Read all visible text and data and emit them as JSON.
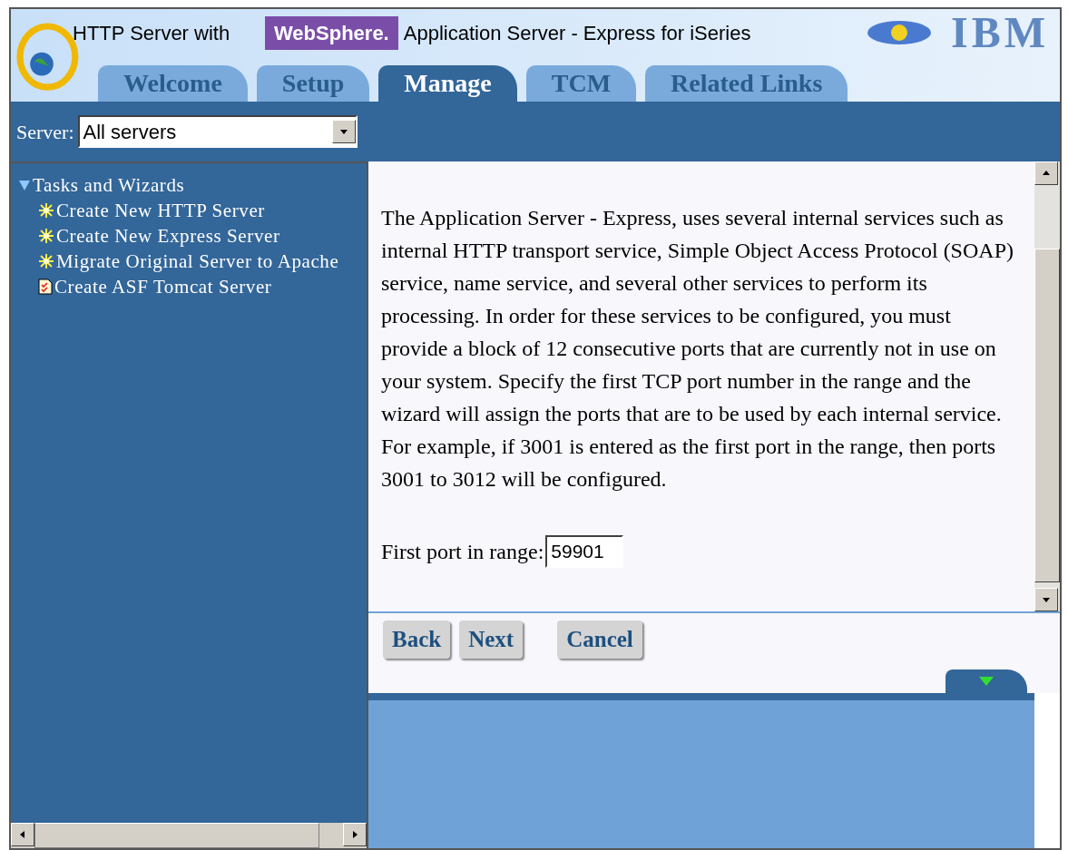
{
  "header": {
    "title": "HTTP Server with",
    "brand": "WebSphere.",
    "subtitle": "Application Server - Express for iSeries",
    "logo": "IBM"
  },
  "tabs": [
    {
      "label": "Welcome",
      "selected": false
    },
    {
      "label": "Setup",
      "selected": false
    },
    {
      "label": "Manage",
      "selected": true
    },
    {
      "label": "TCM",
      "selected": false
    },
    {
      "label": "Related Links",
      "selected": false
    }
  ],
  "server": {
    "label": "Server:",
    "value": "All servers"
  },
  "tree": [
    {
      "label": "Tasks and Wizards",
      "expanded": true,
      "children": [
        {
          "label": "Create New HTTP Server",
          "kind": "wizard"
        },
        {
          "label": "Create New Express Server",
          "kind": "wizard"
        },
        {
          "label": "Migrate Original Server to Apache",
          "kind": "wizard"
        },
        {
          "label": "Create ASF Tomcat Server",
          "kind": "task"
        }
      ]
    }
  ],
  "content": {
    "paragraph": "The Application Server - Express, uses several internal services such as internal HTTP transport service, Simple Object Access Protocol (SOAP) service, name service, and several other services to perform its processing. In order for these services to be configured, you must provide a block of 12 consecutive ports that are currently not in use on your system. Specify the first TCP port number in the range and the wizard will assign the ports that are to be used by each internal service. For example, if 3001 is entered as the first port in the range, then ports 3001 to 3012 will be configured.",
    "field_label": "First port in range:",
    "field_value": "59901"
  },
  "buttons": [
    "Back",
    "Next",
    "Cancel"
  ]
}
